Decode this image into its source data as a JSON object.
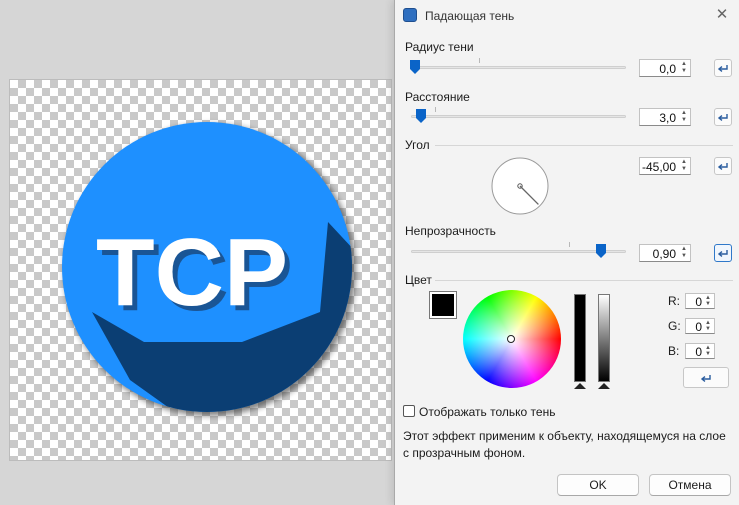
{
  "dialog": {
    "title": "Падающая тень",
    "close_symbol": "✕",
    "shadow_radius": {
      "label": "Радиус тени",
      "value": "0,0",
      "fraction": 0.0
    },
    "distance": {
      "label": "Расстояние",
      "value": "3,0",
      "fraction": 0.03
    },
    "angle": {
      "label": "Угол",
      "value": "-45,00",
      "degrees": -45
    },
    "opacity": {
      "label": "Непрозрачность",
      "value": "0,90",
      "fraction": 0.9
    },
    "color": {
      "label": "Цвет",
      "swatch": "#000000",
      "r_label": "R:",
      "r_value": "0",
      "g_label": "G:",
      "g_value": "0",
      "b_label": "B:",
      "b_value": "0"
    },
    "show_shadow_only": {
      "label": "Отображать только тень",
      "checked": false
    },
    "info": "Этот эффект применим к объекту, находящемуся на слое с прозрачным фоном.",
    "ok_label": "OK",
    "cancel_label": "Отмена"
  },
  "canvas": {
    "logo_text": "TCP",
    "logo_color": "#1e90ff",
    "shadow_color": "#0b3e73"
  },
  "colors": {
    "accent": "#0a64c8"
  },
  "icons": {
    "title": "app-icon",
    "close": "close-icon",
    "reset": "reset-arrow-icon",
    "spin": "spin-arrows-icon"
  }
}
